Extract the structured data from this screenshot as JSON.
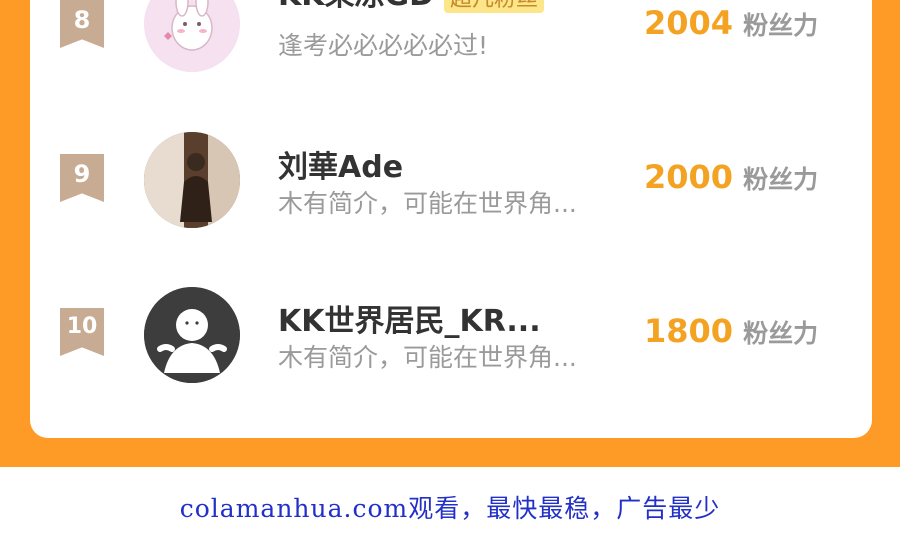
{
  "entries": [
    {
      "rank": "8",
      "name": "KK果冻GD",
      "badge": "超凡粉丝",
      "bio": "逢考必必必必必过!",
      "score": "2004",
      "unit": "粉丝力",
      "avatar": "bunny-avatar"
    },
    {
      "rank": "9",
      "name": "刘華Ade",
      "badge": "",
      "bio": "木有简介，可能在世界角...",
      "score": "2000",
      "unit": "粉丝力",
      "avatar": "photo-avatar"
    },
    {
      "rank": "10",
      "name": "KK世界居民_KR...",
      "badge": "",
      "bio": "木有简介，可能在世界角...",
      "score": "1800",
      "unit": "粉丝力",
      "avatar": "default-user-avatar"
    }
  ],
  "footer": {
    "text": "colamanhua.com观看，最快最稳，广告最少"
  },
  "colors": {
    "accent": "#fd9b26",
    "score": "#f4a222",
    "rank_badge": "#c8ab93",
    "footer_link": "#2330c8"
  }
}
